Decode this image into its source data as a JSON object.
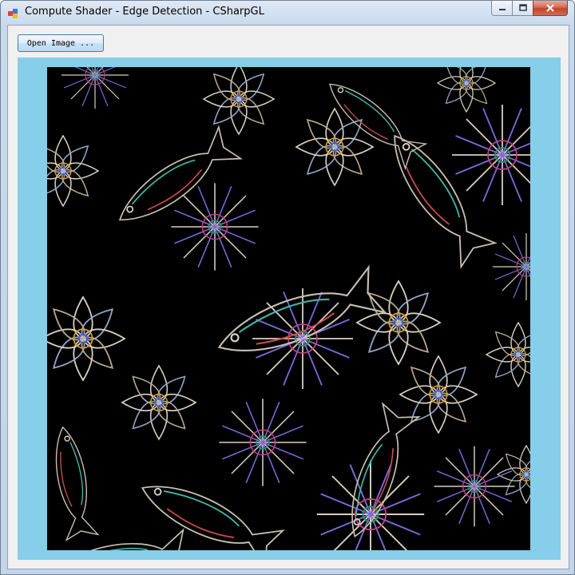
{
  "window": {
    "title": "Compute Shader - Edge Detection - CSharpGL",
    "icon": "application-icon",
    "controls": [
      "minimize-icon",
      "maximize-icon",
      "close-icon"
    ]
  },
  "toolbar": {
    "open_image_label": "Open Image ..."
  },
  "viewport": {
    "background_color": "#87ceeb",
    "content": "edge-detection-output-image",
    "image_background": "#000000"
  }
}
